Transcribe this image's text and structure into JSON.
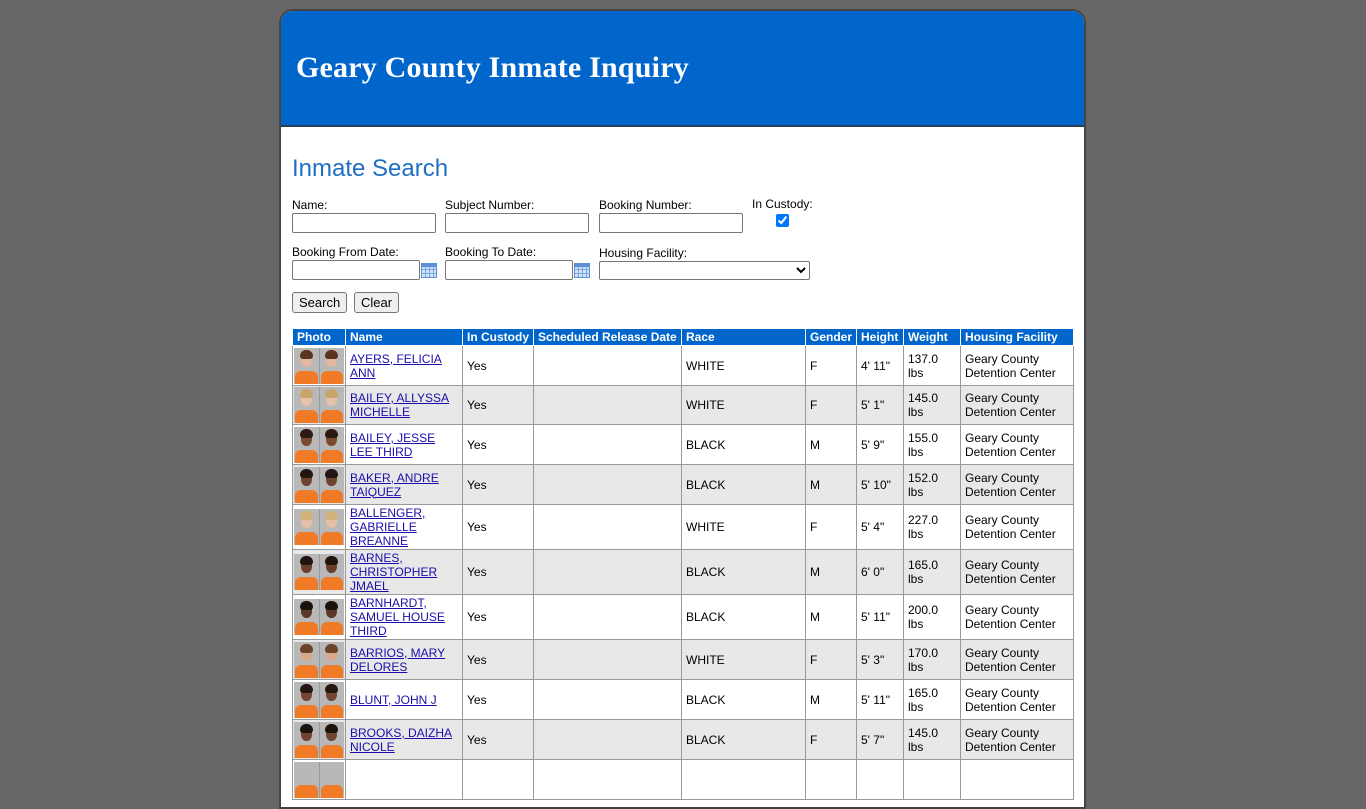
{
  "header": {
    "title": "Geary County Inmate Inquiry"
  },
  "search": {
    "title": "Inmate Search",
    "name_label": "Name:",
    "name_value": "",
    "subject_label": "Subject Number:",
    "subject_value": "",
    "booking_label": "Booking Number:",
    "booking_value": "",
    "custody_label": "In Custody:",
    "custody_checked": true,
    "from_label": "Booking From Date:",
    "from_value": "",
    "to_label": "Booking To Date:",
    "to_value": "",
    "facility_label": "Housing Facility:",
    "facility_value": "",
    "search_button": "Search",
    "clear_button": "Clear"
  },
  "table": {
    "columns": [
      "Photo",
      "Name",
      "In Custody",
      "Scheduled Release Date",
      "Race",
      "Gender",
      "Height",
      "Weight",
      "Housing Facility"
    ],
    "rows": [
      {
        "name": "AYERS, FELICIA ANN",
        "custody": "Yes",
        "release": "",
        "race": "WHITE",
        "gender": "F",
        "height": "4' 11\"",
        "weight": "137.0 lbs",
        "facility": "Geary County Detention Center",
        "skin": "#e2b6a0",
        "hair": "#5a3420"
      },
      {
        "name": "BAILEY, ALLYSSA MICHELLE",
        "custody": "Yes",
        "release": "",
        "race": "WHITE",
        "gender": "F",
        "height": "5' 1\"",
        "weight": "145.0 lbs",
        "facility": "Geary County Detention Center",
        "skin": "#e7c2aa",
        "hair": "#c9a46a"
      },
      {
        "name": "BAILEY, JESSE LEE THIRD",
        "custody": "Yes",
        "release": "",
        "race": "BLACK",
        "gender": "M",
        "height": "5' 9\"",
        "weight": "155.0 lbs",
        "facility": "Geary County Detention Center",
        "skin": "#7a4a30",
        "hair": "#2a1a12"
      },
      {
        "name": "BAKER, ANDRE TAIQUEZ",
        "custody": "Yes",
        "release": "",
        "race": "BLACK",
        "gender": "M",
        "height": "5' 10\"",
        "weight": "152.0 lbs",
        "facility": "Geary County Detention Center",
        "skin": "#6e4430",
        "hair": "#231610"
      },
      {
        "name": "BALLENGER, GABRIELLE BREANNE",
        "custody": "Yes",
        "release": "",
        "race": "WHITE",
        "gender": "F",
        "height": "5' 4\"",
        "weight": "227.0 lbs",
        "facility": "Geary County Detention Center",
        "skin": "#e6bfa6",
        "hair": "#d1b27a"
      },
      {
        "name": "BARNES, CHRISTOPHER JMAEL",
        "custody": "Yes",
        "release": "",
        "race": "BLACK",
        "gender": "M",
        "height": "6' 0\"",
        "weight": "165.0 lbs",
        "facility": "Geary County Detention Center",
        "skin": "#6a3f2a",
        "hair": "#1f140e"
      },
      {
        "name": "BARNHARDT, SAMUEL HOUSE THIRD",
        "custody": "Yes",
        "release": "",
        "race": "BLACK",
        "gender": "M",
        "height": "5' 11\"",
        "weight": "200.0 lbs",
        "facility": "Geary County Detention Center",
        "skin": "#5c3828",
        "hair": "#1b120c"
      },
      {
        "name": "BARRIOS, MARY DELORES",
        "custody": "Yes",
        "release": "",
        "race": "WHITE",
        "gender": "F",
        "height": "5' 3\"",
        "weight": "170.0 lbs",
        "facility": "Geary County Detention Center",
        "skin": "#d9a98c",
        "hair": "#6a4428"
      },
      {
        "name": "BLUNT, JOHN J",
        "custody": "Yes",
        "release": "",
        "race": "BLACK",
        "gender": "M",
        "height": "5' 11\"",
        "weight": "165.0 lbs",
        "facility": "Geary County Detention Center",
        "skin": "#744632",
        "hair": "#241712"
      },
      {
        "name": "BROOKS, DAIZHA NICOLE",
        "custody": "Yes",
        "release": "",
        "race": "BLACK",
        "gender": "F",
        "height": "5' 7\"",
        "weight": "145.0 lbs",
        "facility": "Geary County Detention Center",
        "skin": "#6f4431",
        "hair": "#1d130d"
      },
      {
        "name": "",
        "custody": "",
        "release": "",
        "race": "",
        "gender": "",
        "height": "",
        "weight": "",
        "facility": "",
        "skin": "#b8b8b8",
        "hair": "#b8b8b8"
      }
    ]
  }
}
